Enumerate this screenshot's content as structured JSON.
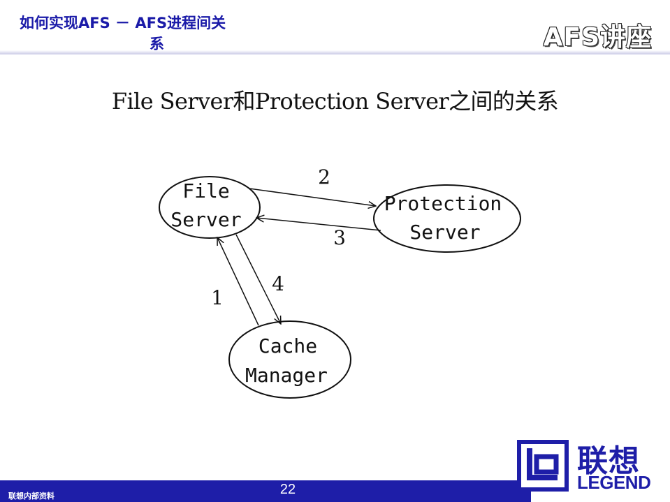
{
  "header": {
    "title_line1": "如何实现AFS － AFS进程间关",
    "title_line2": "系",
    "brand": "AFS讲座"
  },
  "slide": {
    "heading": "File Server和Protection Server之间的关系"
  },
  "diagram": {
    "nodes": {
      "file_server": {
        "line1": "File",
        "line2": "Server"
      },
      "protection_server": {
        "line1": "Protection",
        "line2": "Server"
      },
      "cache_manager": {
        "line1": "Cache",
        "line2": "Manager"
      }
    },
    "edges": {
      "fs_to_ps": "2",
      "ps_to_fs": "3",
      "cm_to_fs": "1",
      "fs_to_cm": "4"
    }
  },
  "footer": {
    "left_text": "联想内部资料",
    "page_number": "22"
  },
  "logo": {
    "zh": "联想",
    "en": "LEGEND"
  },
  "colors": {
    "accent": "#1e1ea8",
    "title": "#1a1aa8"
  }
}
